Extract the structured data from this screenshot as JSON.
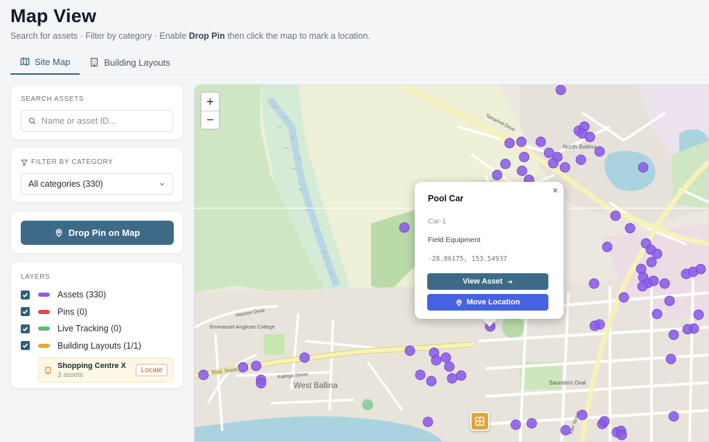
{
  "header": {
    "title": "Map View",
    "subtitle_pre": "Search for assets · Filter by category · Enable ",
    "subtitle_bold": "Drop Pin",
    "subtitle_post": " then click the map to mark a location."
  },
  "tabs": [
    {
      "label": "Site Map",
      "icon": "map-icon",
      "active": true
    },
    {
      "label": "Building Layouts",
      "icon": "building-icon",
      "active": false
    }
  ],
  "search": {
    "label": "SEARCH ASSETS",
    "placeholder": "Name or asset ID..."
  },
  "filter": {
    "label": "FILTER BY CATEGORY",
    "selected": "All categories (330)"
  },
  "drop_pin": {
    "label": "Drop Pin on Map"
  },
  "layers": {
    "label": "LAYERS",
    "items": [
      {
        "label": "Assets (330)",
        "color": "#8b5ce8",
        "checked": true
      },
      {
        "label": "Pins (0)",
        "color": "#e04848",
        "checked": true
      },
      {
        "label": "Live Tracking (0)",
        "color": "#5cba7d",
        "checked": true
      },
      {
        "label": "Building Layouts (1/1)",
        "color": "#e8a83a",
        "checked": true
      }
    ],
    "building": {
      "name": "Shopping Centre X",
      "count": "3 assets",
      "locate_label": "Locate"
    }
  },
  "map": {
    "zoom_in": "+",
    "zoom_out": "−",
    "labels": {
      "west_ballina": "West Ballina",
      "north_ballina": "North Ballina",
      "river_street": "River Street",
      "tamarind_drive": "Tamarind Drive",
      "emmanuel_college": "Emmanuel Anglican College",
      "saunders_oval": "Saunders Oval",
      "kerr_street": "Kerr Street",
      "horizon_drive": "Horizon Drive",
      "kalinga_street": "Kalinga Street"
    },
    "asset_color": "#8b5ce8"
  },
  "popup": {
    "title": "Pool Car",
    "close": "×",
    "asset_id": "Car-1",
    "category": "Field Equipment",
    "coords": "-28.86175, 153.54937",
    "view_label": "View Asset",
    "move_label": "Move Location"
  }
}
